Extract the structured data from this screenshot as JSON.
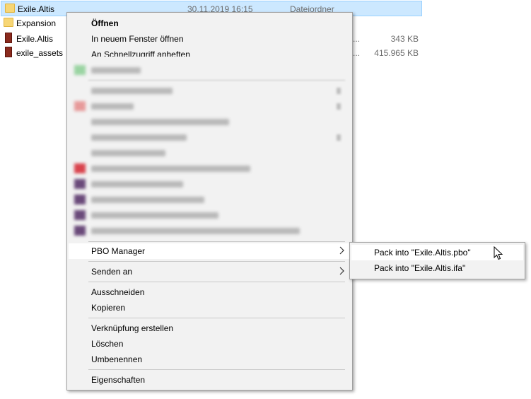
{
  "files": [
    {
      "name": "Exile.Altis",
      "date": "30.11.2019 16:15",
      "type": "Dateiordner",
      "size": "",
      "icon": "folder-icon",
      "selected": true
    },
    {
      "name": "Expansion",
      "date": "",
      "type": "",
      "size": "",
      "icon": "folder-icon",
      "selected": false
    },
    {
      "name": "Exile.Altis",
      "date": "",
      "type": "",
      "size": "343 KB",
      "icon": "archive-icon",
      "selected": false
    },
    {
      "name": "exile_assets",
      "date": "",
      "type": "",
      "size": "415.965 KB",
      "icon": "archive-icon",
      "selected": false
    }
  ],
  "context_menu": {
    "open": "Öffnen",
    "open_new_window": "In neuem Fenster öffnen",
    "pin_quick_access": "An Schnellzugriff anheften",
    "pbo_manager": "PBO Manager",
    "send_to": "Senden an",
    "cut": "Ausschneiden",
    "copy": "Kopieren",
    "create_shortcut": "Verknüpfung erstellen",
    "delete": "Löschen",
    "rename": "Umbenennen",
    "properties": "Eigenschaften"
  },
  "submenu": {
    "pack_pbo": "Pack into \"Exile.Altis.pbo\"",
    "pack_ifa": "Pack into \"Exile.Altis.ifa\""
  },
  "colors": {
    "selection_bg": "#cce8ff",
    "menu_bg": "#f2f2f2",
    "folder": "#f7d675",
    "archive": "#8a2a1d"
  }
}
